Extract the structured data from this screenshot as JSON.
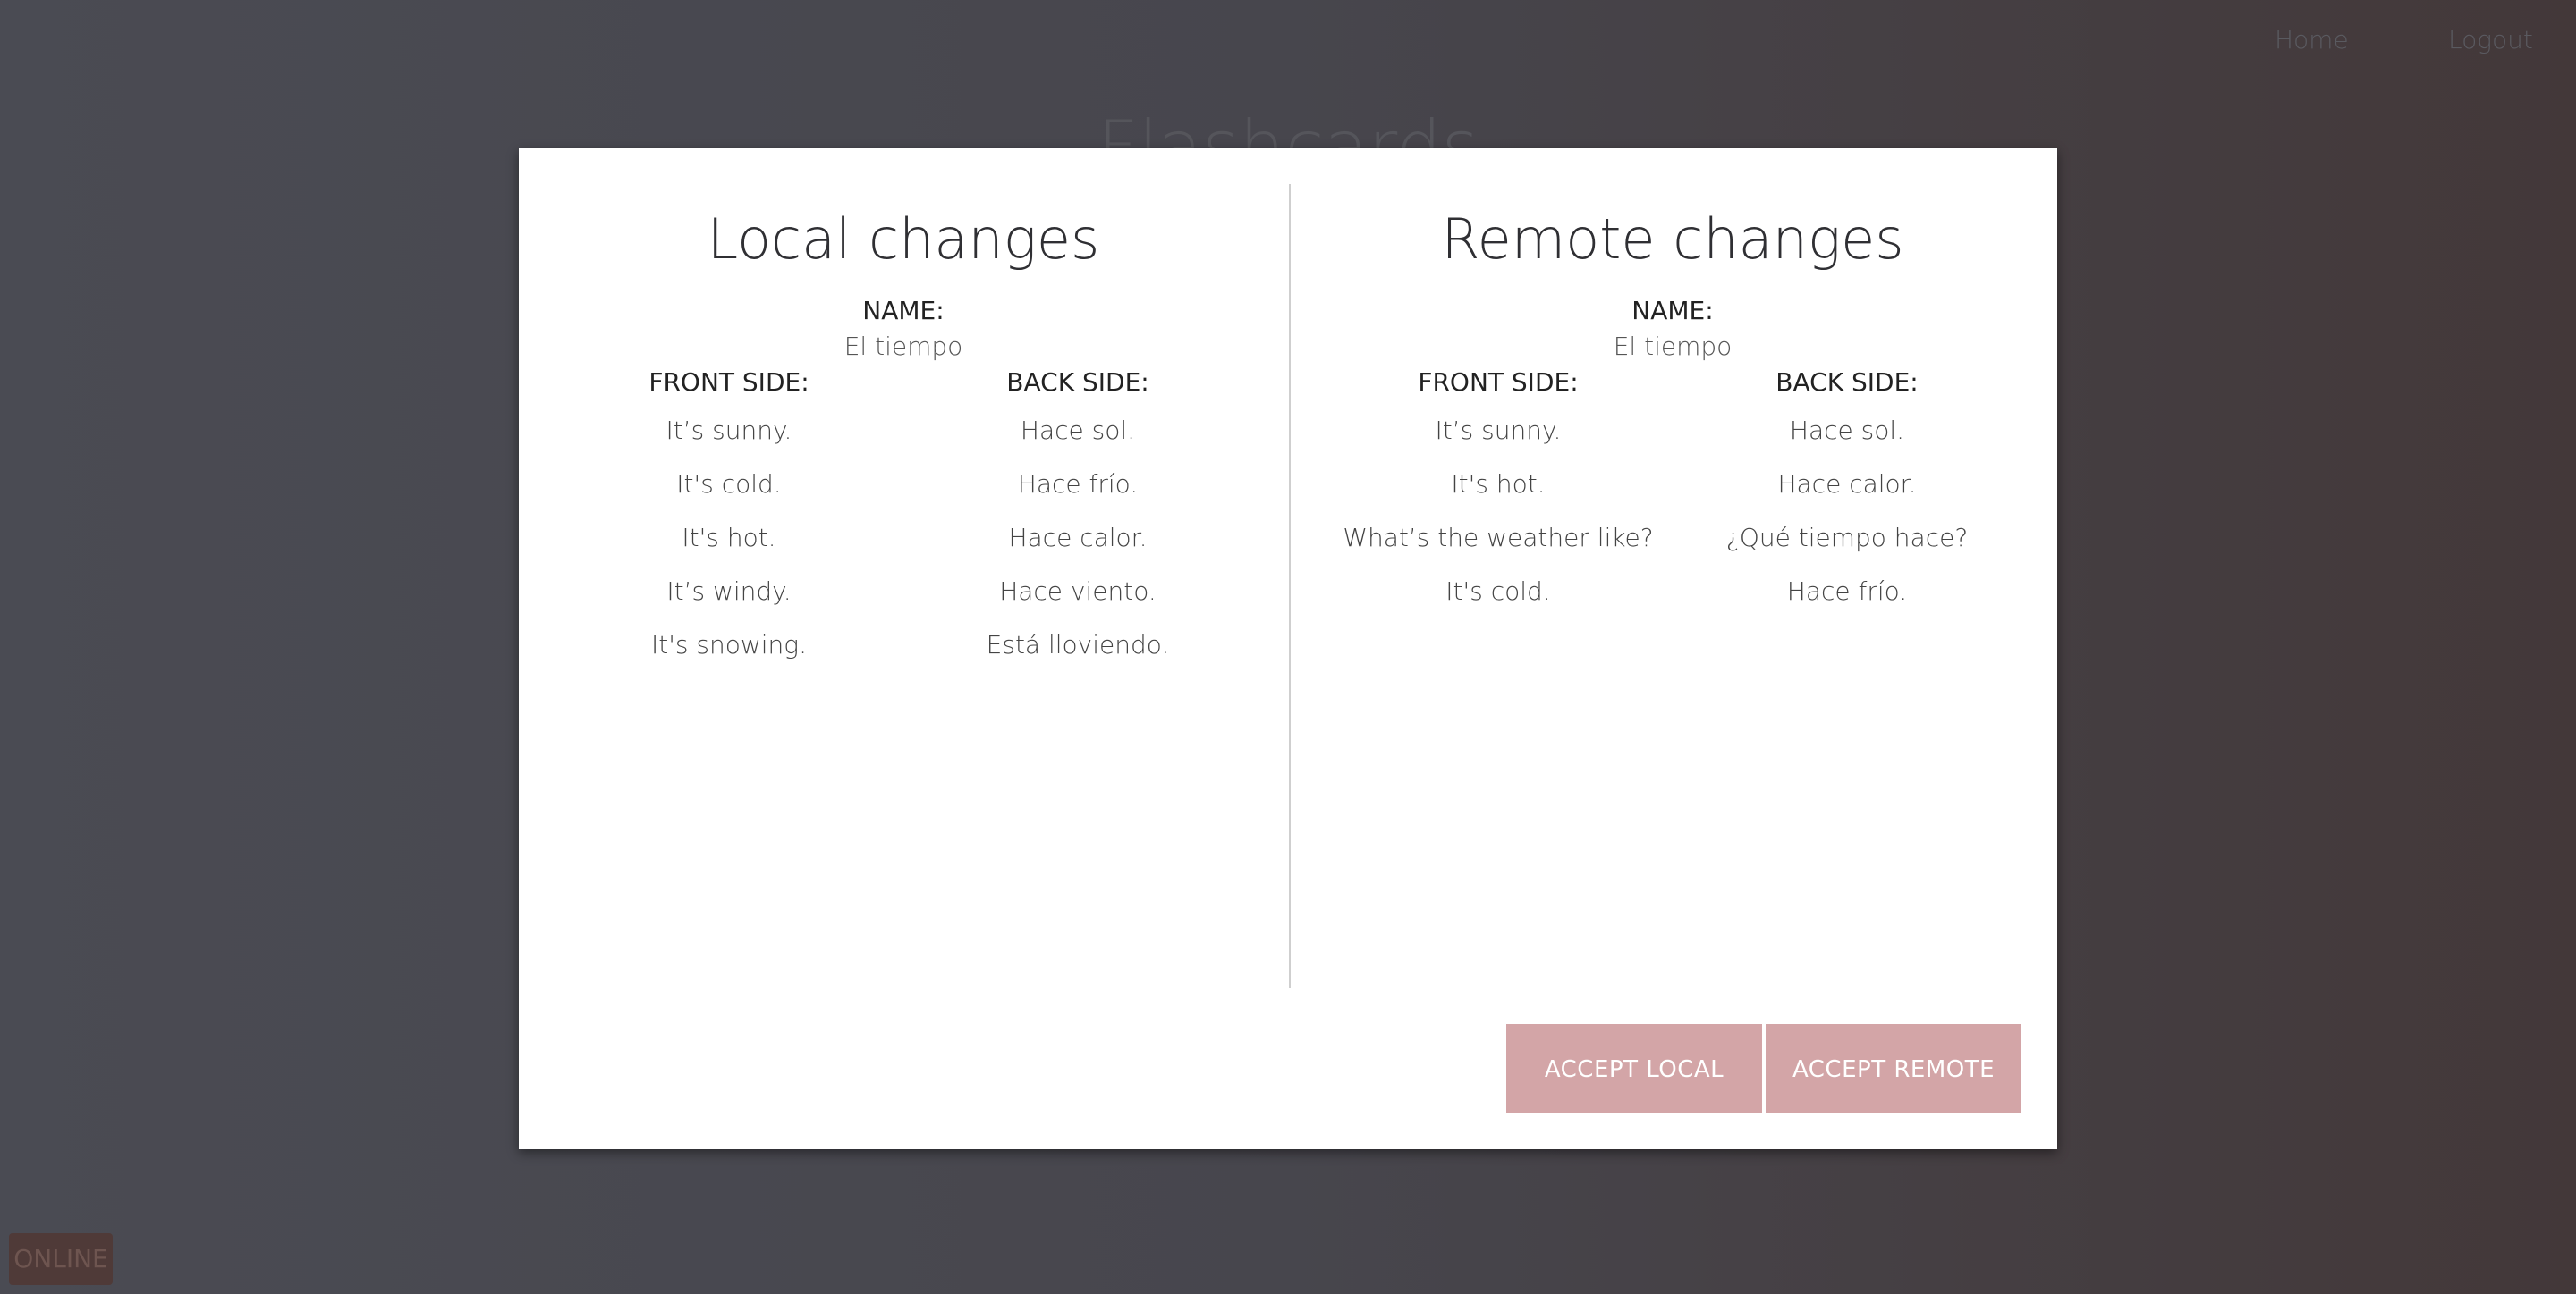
{
  "nav": {
    "home_label": "Home",
    "logout_label": "Logout"
  },
  "page": {
    "title": "Flashcards"
  },
  "status": {
    "online_label": "ONLINE"
  },
  "modal": {
    "local": {
      "title": "Local changes",
      "name_label": "NAME:",
      "name_value": "El tiempo",
      "front_header": "FRONT SIDE:",
      "back_header": "BACK SIDE:",
      "cards": [
        {
          "front": "It’s sunny.",
          "back": "Hace sol."
        },
        {
          "front": "It's cold.",
          "back": "Hace frío."
        },
        {
          "front": "It's hot.",
          "back": "Hace calor."
        },
        {
          "front": "It’s windy.",
          "back": "Hace viento."
        },
        {
          "front": "It's snowing.",
          "back": "Está lloviendo."
        }
      ]
    },
    "remote": {
      "title": "Remote changes",
      "name_label": "NAME:",
      "name_value": "El tiempo",
      "front_header": "FRONT SIDE:",
      "back_header": "BACK SIDE:",
      "cards": [
        {
          "front": "It’s sunny.",
          "back": "Hace sol."
        },
        {
          "front": "It's hot.",
          "back": "Hace calor."
        },
        {
          "front": "What’s the weather like?",
          "back": "¿Qué tiempo hace?"
        },
        {
          "front": "It's cold.",
          "back": "Hace frío."
        }
      ]
    },
    "buttons": {
      "accept_local": "ACCEPT LOCAL",
      "accept_remote": "ACCEPT REMOTE"
    }
  },
  "colors": {
    "button_bg": "#d3a5a7",
    "modal_bg": "#ffffff",
    "backdrop_left": "#4a4b53",
    "backdrop_right": "#433839"
  }
}
